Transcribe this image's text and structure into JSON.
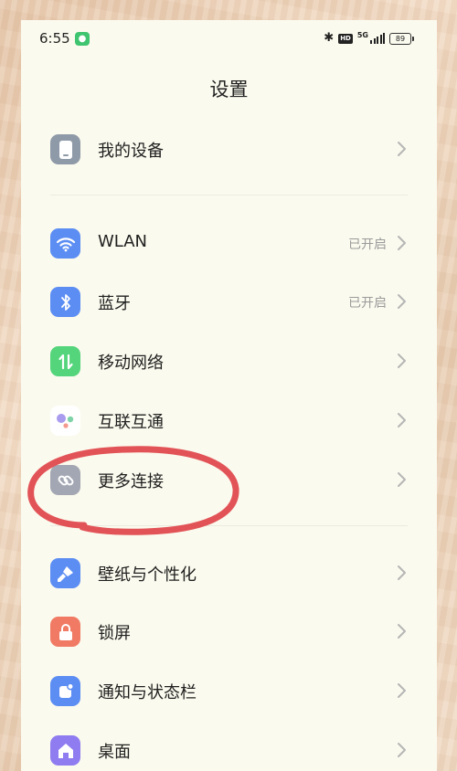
{
  "status_bar": {
    "time": "6:55",
    "network": "5G",
    "hd": "HD",
    "battery": "89"
  },
  "header": {
    "title": "设置"
  },
  "items": [
    {
      "label": "我的设备",
      "icon": "phone-device-icon",
      "color": "#8f9aa8"
    },
    {
      "label": "WLAN",
      "status": "已开启",
      "icon": "wifi-icon",
      "color": "#5b8df3"
    },
    {
      "label": "蓝牙",
      "status": "已开启",
      "icon": "bluetooth-icon",
      "color": "#5b8df3"
    },
    {
      "label": "移动网络",
      "icon": "mobile-data-icon",
      "color": "#54d47b"
    },
    {
      "label": "互联互通",
      "icon": "interconnect-dots-icon",
      "color": "#b8a8ee"
    },
    {
      "label": "更多连接",
      "icon": "link-icon",
      "color": "#a2a7b3"
    },
    {
      "label": "壁纸与个性化",
      "icon": "brush-icon",
      "color": "#5b8df3"
    },
    {
      "label": "锁屏",
      "icon": "lock-icon",
      "color": "#f07a63"
    },
    {
      "label": "通知与状态栏",
      "icon": "notification-icon",
      "color": "#5b8df3"
    },
    {
      "label": "桌面",
      "icon": "home-icon",
      "color": "#8f7cf0"
    }
  ]
}
